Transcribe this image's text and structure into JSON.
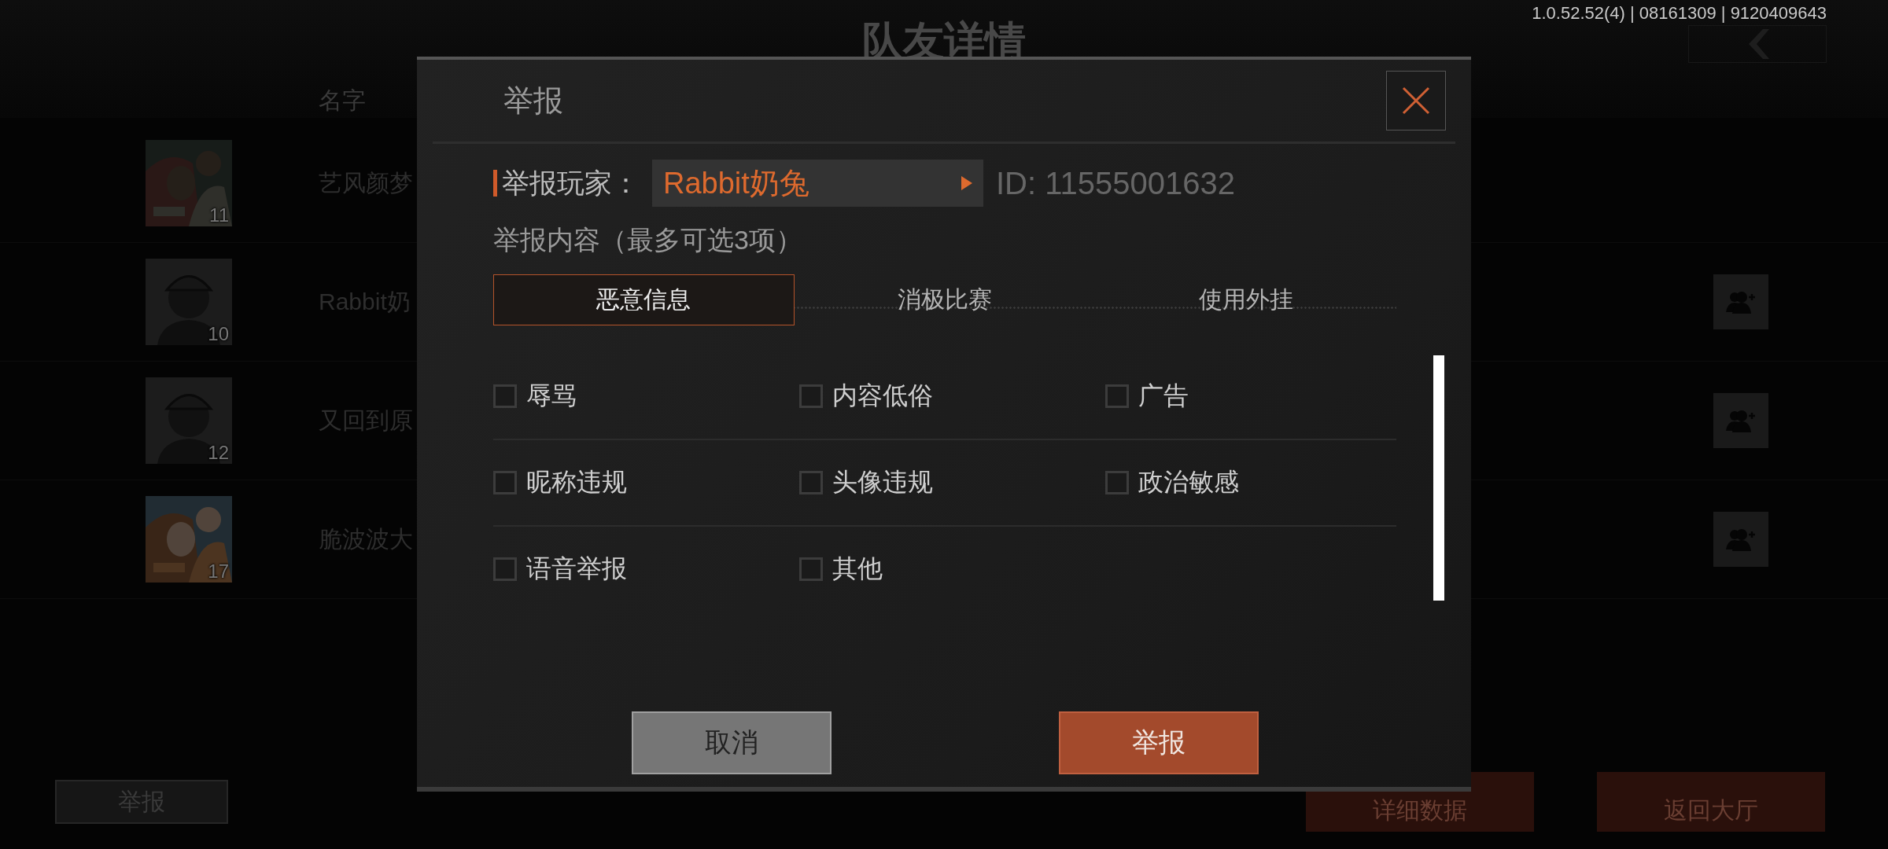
{
  "background": {
    "title": "队友详情",
    "version": "1.0.52.52(4) | 08161309 | 9120409643",
    "column_header": "名字",
    "teammates": [
      {
        "name": "艺风颜梦",
        "level": "11",
        "kind": "picture",
        "add_friend": false
      },
      {
        "name": "Rabbit奶",
        "level": "10",
        "kind": "default",
        "add_friend": true
      },
      {
        "name": "又回到原",
        "level": "12",
        "kind": "default",
        "add_friend": true
      },
      {
        "name": "脆波波大",
        "level": "17",
        "kind": "picture",
        "add_friend": true
      }
    ],
    "buttons": [
      {
        "label": "举报",
        "kind": "plain"
      },
      {
        "label": "详细数据",
        "kind": "accent"
      },
      {
        "label": "返回大厅",
        "kind": "accent"
      }
    ]
  },
  "dialog": {
    "title": "举报",
    "player_label": "举报玩家：",
    "player_name": "Rabbit奶兔",
    "player_id": "ID: 11555001632",
    "content_label": "举报内容（最多可选3项）",
    "tabs": [
      {
        "label": "恶意信息",
        "selected": true
      },
      {
        "label": "消极比赛",
        "selected": false
      },
      {
        "label": "使用外挂",
        "selected": false
      }
    ],
    "options": [
      {
        "label": "辱骂",
        "checked": false
      },
      {
        "label": "内容低俗",
        "checked": false
      },
      {
        "label": "广告",
        "checked": false
      },
      {
        "label": "昵称违规",
        "checked": false
      },
      {
        "label": "头像违规",
        "checked": false
      },
      {
        "label": "政治敏感",
        "checked": false
      },
      {
        "label": "语音举报",
        "checked": false
      },
      {
        "label": "其他",
        "checked": false
      }
    ],
    "buttons": [
      {
        "label": "取消",
        "kind": "cancel"
      },
      {
        "label": "举报",
        "kind": "confirm"
      }
    ]
  }
}
